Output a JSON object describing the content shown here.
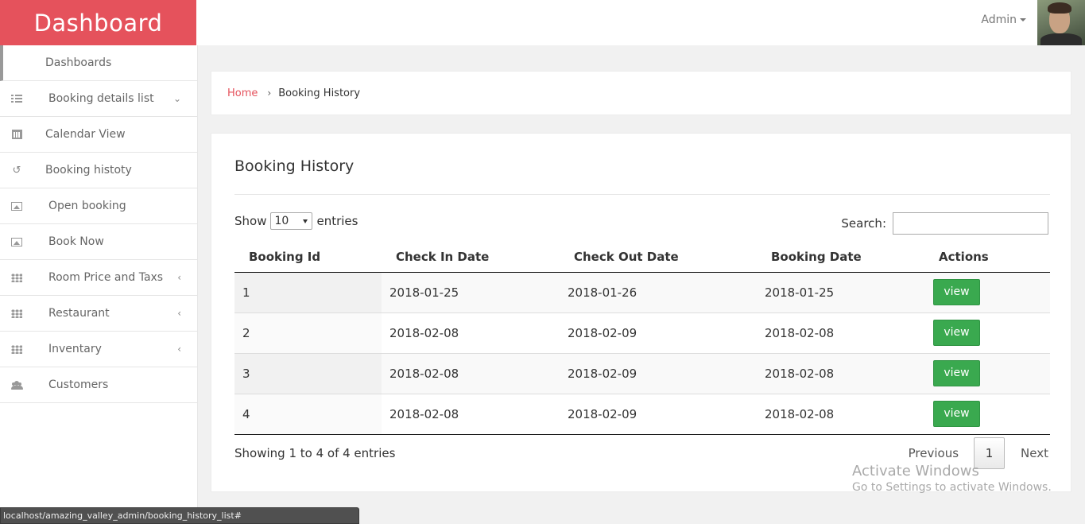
{
  "brand": "Dashboard",
  "header": {
    "user_label": "Admin"
  },
  "sidebar": {
    "items": [
      {
        "label": "Dashboards",
        "icon": "none"
      },
      {
        "label": "Booking details list",
        "icon": "list-icon",
        "arrow": "⌄"
      },
      {
        "label": "Calendar View",
        "icon": "calendar-icon"
      },
      {
        "label": "Booking histoty",
        "icon": "history-icon"
      },
      {
        "label": "Open booking",
        "icon": "image-icon"
      },
      {
        "label": "Book Now",
        "icon": "image-icon"
      },
      {
        "label": "Room Price and Taxs",
        "icon": "grid-icon",
        "arrow": "‹"
      },
      {
        "label": "Restaurant",
        "icon": "grid-icon",
        "arrow": "‹"
      },
      {
        "label": "Inventary",
        "icon": "grid-icon",
        "arrow": "‹"
      },
      {
        "label": "Customers",
        "icon": "users-icon"
      }
    ]
  },
  "breadcrumb": {
    "home": "Home",
    "current": "Booking History"
  },
  "panel": {
    "title": "Booking History",
    "show_label": "Show",
    "entries_label": "entries",
    "page_size": "10",
    "search_label": "Search:",
    "search_value": ""
  },
  "table": {
    "headers": [
      "Booking Id",
      "Check In Date",
      "Check Out Date",
      "Booking Date",
      "Actions"
    ],
    "rows": [
      {
        "id": "1",
        "check_in": "2018-01-25",
        "check_out": "2018-01-26",
        "booking_date": "2018-01-25",
        "action": "view"
      },
      {
        "id": "2",
        "check_in": "2018-02-08",
        "check_out": "2018-02-09",
        "booking_date": "2018-02-08",
        "action": "view"
      },
      {
        "id": "3",
        "check_in": "2018-02-08",
        "check_out": "2018-02-09",
        "booking_date": "2018-02-08",
        "action": "view"
      },
      {
        "id": "4",
        "check_in": "2018-02-08",
        "check_out": "2018-02-09",
        "booking_date": "2018-02-08",
        "action": "view"
      }
    ]
  },
  "footer": {
    "info": "Showing 1 to 4 of 4 entries",
    "previous": "Previous",
    "page": "1",
    "next": "Next"
  },
  "watermark": {
    "line1": "Activate Windows",
    "line2": "Go to Settings to activate Windows."
  },
  "status_url": "localhost/amazing_valley_admin/booking_history_list#",
  "colors": {
    "brand": "#e5525c",
    "view_button": "#3aa94f"
  }
}
